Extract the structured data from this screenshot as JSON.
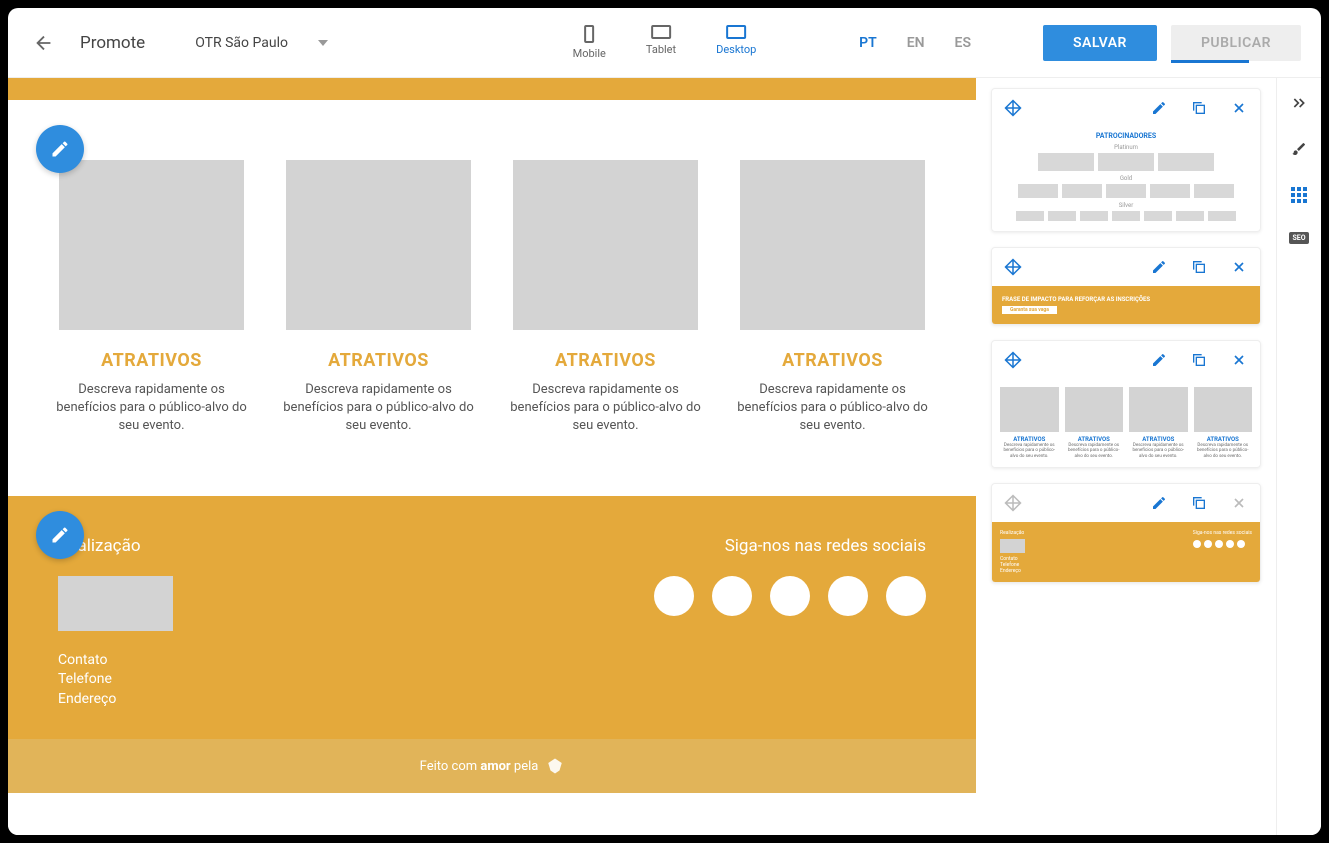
{
  "header": {
    "title": "Promote",
    "dropdown": "OTR São Paulo",
    "devices": {
      "mobile": "Mobile",
      "tablet": "Tablet",
      "desktop": "Desktop"
    },
    "langs": {
      "pt": "PT",
      "en": "EN",
      "es": "ES"
    },
    "save": "SALVAR",
    "publish": "PUBLICAR"
  },
  "attractions": {
    "title": "ATRATIVOS",
    "desc": "Descreva rapidamente os benefícios para o público-alvo do seu evento."
  },
  "footer": {
    "left_title": "Realização",
    "contact": "Contato",
    "phone": "Telefone",
    "address": "Endereço",
    "right_title": "Siga-nos nas redes sociais",
    "made_pre": "Feito com ",
    "made_strong": "amor",
    "made_post": " pela"
  },
  "panels": {
    "sponsors": {
      "title": "PATROCINADORES",
      "tiers": {
        "platinum": "Platinum",
        "gold": "Gold",
        "silver": "Silver"
      }
    },
    "cta": {
      "text": "FRASE DE IMPACTO PARA REFORÇAR AS INSCRIÇÕES",
      "btn": "Garanta sua vaga"
    },
    "mini_attr": {
      "title": "ATRATIVOS",
      "desc": "Descreva rapidamente os benefícios para o público-alvo do seu evento."
    },
    "mini_footer": {
      "left": "Realização",
      "right": "Siga-nos nas redes sociais",
      "contact": "Contato",
      "phone": "Telefone",
      "address": "Endereço"
    }
  },
  "rail": {
    "seo": "SEO"
  }
}
